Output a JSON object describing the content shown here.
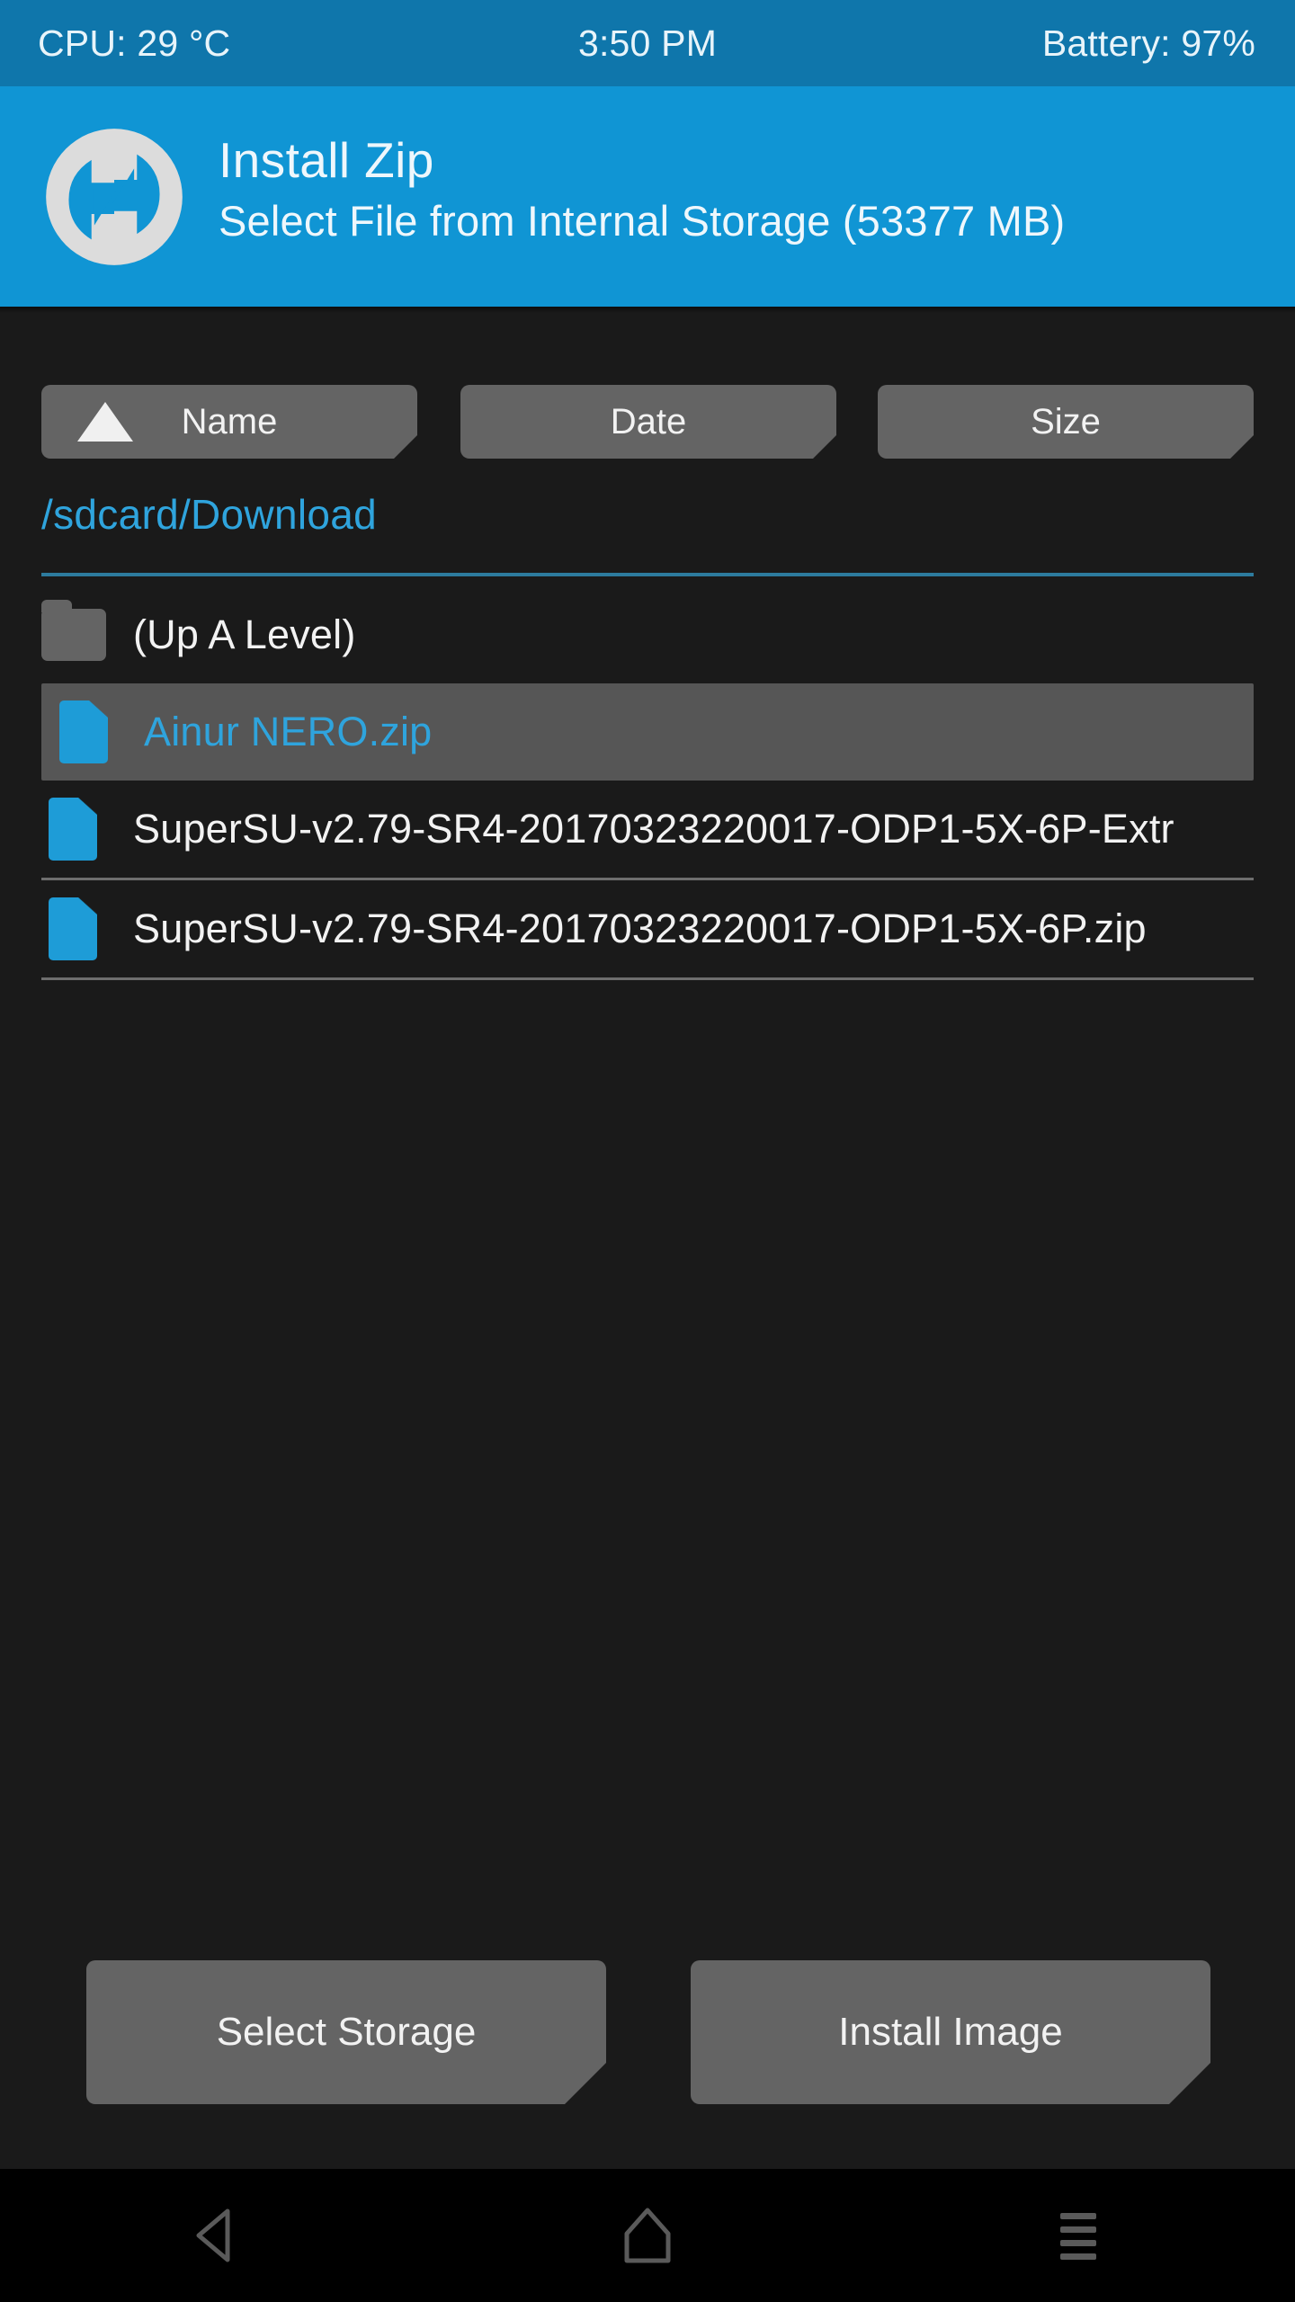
{
  "status_bar": {
    "cpu": "CPU: 29 °C",
    "clock": "3:50 PM",
    "battery": "Battery: 97%"
  },
  "header": {
    "title": "Install Zip",
    "subtitle": "Select File from Internal Storage (53377 MB)",
    "logo_icon": "twrp-logo-icon",
    "background_color": "#1095d4"
  },
  "sort_bar": {
    "sort_icon": "sort-ascending-triangle-icon",
    "buttons": [
      {
        "label": "Name",
        "active": true
      },
      {
        "label": "Date",
        "active": false
      },
      {
        "label": "Size",
        "active": false
      }
    ]
  },
  "path": {
    "current": "/sdcard/Download",
    "color": "#2fa4dd"
  },
  "file_list": {
    "rows": [
      {
        "label": "(Up A Level)",
        "icon": "folder-icon",
        "selected": false,
        "divider": false
      },
      {
        "label": "Ainur NERO.zip",
        "icon": "file-icon",
        "selected": true,
        "divider": false
      },
      {
        "label": "SuperSU-v2.79-SR4-20170323220017-ODP1-5X-6P-Extr",
        "icon": "file-icon",
        "selected": false,
        "divider": true
      },
      {
        "label": "SuperSU-v2.79-SR4-20170323220017-ODP1-5X-6P.zip",
        "icon": "file-icon",
        "selected": false,
        "divider": true
      }
    ],
    "selected_color": "#565656"
  },
  "actions": {
    "select_storage": "Select Storage",
    "install_image": "Install Image"
  },
  "nav_bar": {
    "back": "back-icon",
    "home": "home-icon",
    "menu": "menu-icon"
  },
  "colors": {
    "status_bar": "#0f76ab",
    "accent_blue": "#1095d4",
    "background": "#1a1a1a",
    "button_gray": "#646464"
  }
}
